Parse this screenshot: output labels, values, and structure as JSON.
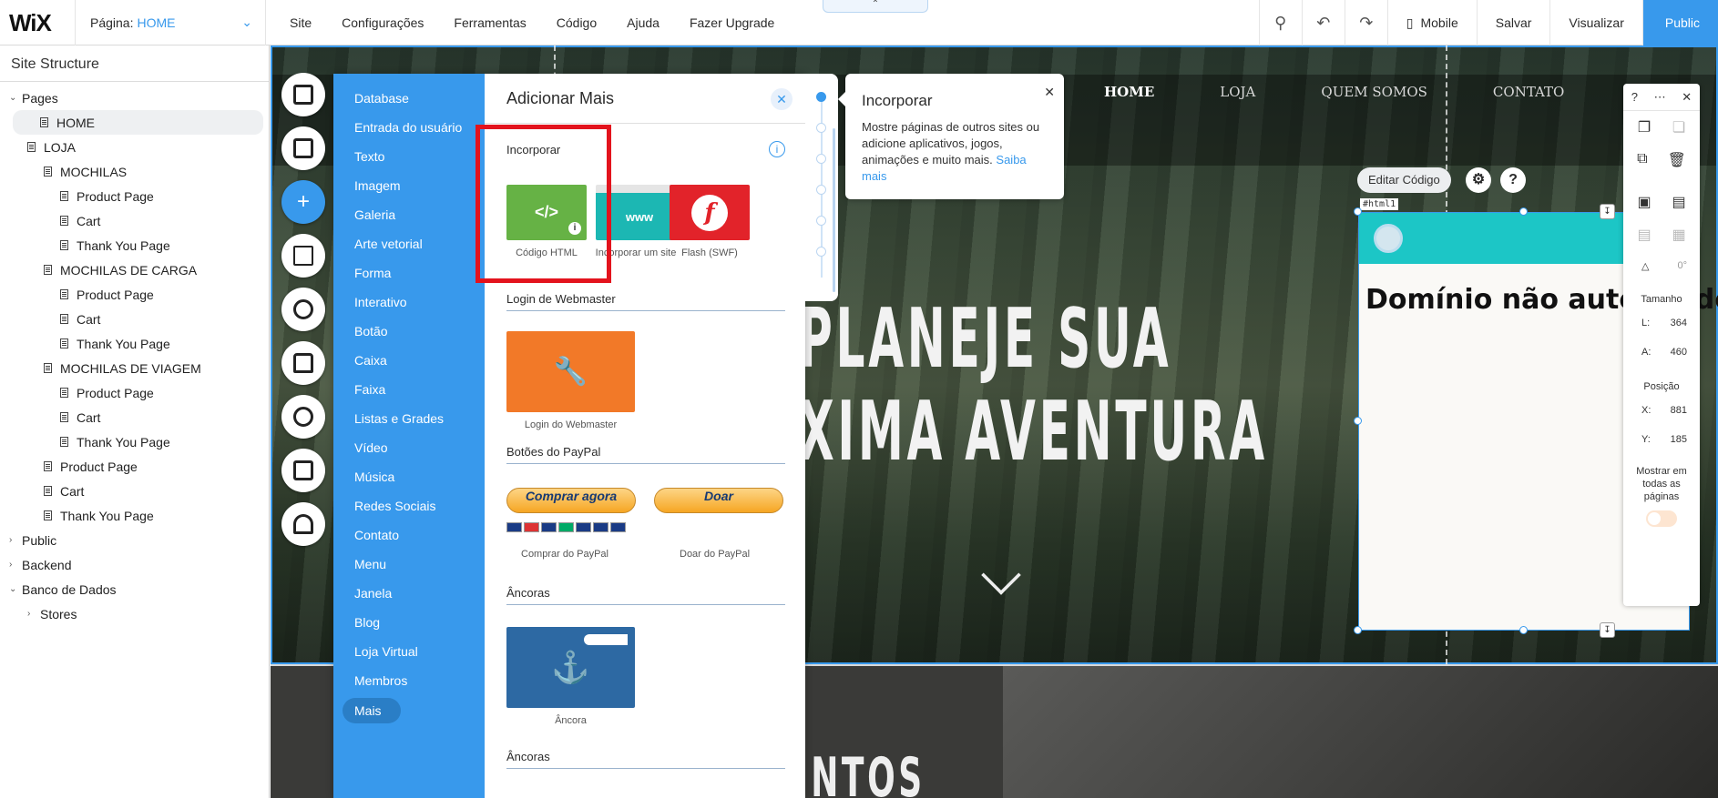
{
  "topbar": {
    "logo": "WiX",
    "page_label": "Página:",
    "page_value": "HOME",
    "menu": [
      "Site",
      "Configurações",
      "Ferramentas",
      "Código",
      "Ajuda",
      "Fazer Upgrade"
    ],
    "mobile_label": "Mobile",
    "save_label": "Salvar",
    "preview_label": "Visualizar",
    "publish_label": "Public"
  },
  "site_structure": {
    "title": "Site Structure",
    "pages_label": "Pages",
    "items": [
      {
        "label": "HOME",
        "level": 1
      },
      {
        "label": "LOJA",
        "level": 1
      },
      {
        "label": "MOCHILAS",
        "level": 2
      },
      {
        "label": "Product Page",
        "level": 3
      },
      {
        "label": "Cart",
        "level": 3
      },
      {
        "label": "Thank You Page",
        "level": 3
      },
      {
        "label": "MOCHILAS DE CARGA",
        "level": 2
      },
      {
        "label": "Product Page",
        "level": 3
      },
      {
        "label": "Cart",
        "level": 3
      },
      {
        "label": "Thank You Page",
        "level": 3
      },
      {
        "label": "MOCHILAS DE VIAGEM",
        "level": 2
      },
      {
        "label": "Product Page",
        "level": 3
      },
      {
        "label": "Cart",
        "level": 3
      },
      {
        "label": "Thank You Page",
        "level": 3
      },
      {
        "label": "Product Page",
        "level": 2
      },
      {
        "label": "Cart",
        "level": 2
      },
      {
        "label": "Thank You Page",
        "level": 2
      }
    ],
    "public_label": "Public",
    "backend_label": "Backend",
    "database_label": "Banco de Dados",
    "stores_label": "Stores"
  },
  "add_panel": {
    "categories": [
      "Database",
      "Entrada do usuário",
      "Texto",
      "Imagem",
      "Galeria",
      "Arte vetorial",
      "Forma",
      "Interativo",
      "Botão",
      "Caixa",
      "Faixa",
      "Listas e Grades",
      "Vídeo",
      "Música",
      "Redes Sociais",
      "Contato",
      "Menu",
      "Janela",
      "Blog",
      "Loja Virtual",
      "Membros",
      "Mais"
    ],
    "title": "Adicionar Mais",
    "sec_incorporar": "Incorporar",
    "html_code_label": "Código HTML",
    "html_code_icon": "</>",
    "embed_site_label": "Incorporar um site",
    "embed_site_icon": "www",
    "flash_label": "Flash (SWF)",
    "flash_icon": "f",
    "sec_webmaster": "Login de Webmaster",
    "webmaster_label": "Login do Webmaster",
    "sec_paypal": "Botões do PayPal",
    "paypal_buy_btn": "Comprar agora",
    "paypal_donate_btn": "Doar",
    "paypal_buy_label": "Comprar do PayPal",
    "paypal_donate_label": "Doar do PayPal",
    "sec_ancoras": "Âncoras",
    "anchor_label": "Âncora",
    "sec_ancoras2": "Âncoras"
  },
  "tooltip": {
    "title": "Incorporar",
    "text": "Mostre páginas de outros sites ou adicione aplicativos, jogos, animações e muito mais.",
    "link": "Saiba mais"
  },
  "site_preview": {
    "nav": [
      "HOME",
      "LOJA",
      "QUEM SOMOS",
      "CONTATO"
    ],
    "hero_line1": "PLANEJE SUA",
    "hero_line2": "XIMA AVENTURA",
    "lower_text": "ENTOS"
  },
  "html_widget": {
    "edit_code_label": "Editar Código",
    "tag": "#html1",
    "message": "Domínio não autorizado"
  },
  "tools_panel": {
    "rotation": "0°",
    "size_label": "Tamanho",
    "width_label": "L:",
    "width_value": "364",
    "height_label": "A:",
    "height_value": "460",
    "position_label": "Posição",
    "x_label": "X:",
    "x_value": "881",
    "y_label": "Y:",
    "y_value": "185",
    "show_all_label": "Mostrar em todas as páginas"
  },
  "colors": {
    "accent": "#3899ec",
    "highlight": "#e3131d",
    "widget_header": "#1cc6c6"
  }
}
